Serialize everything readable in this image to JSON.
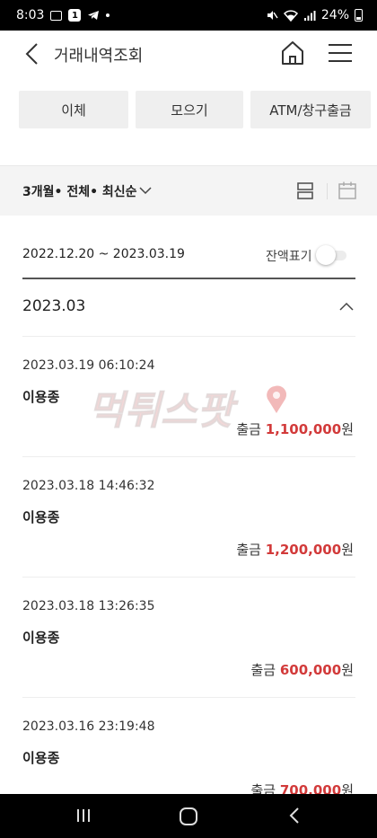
{
  "status_bar": {
    "time": "8:03",
    "battery": "24%"
  },
  "header": {
    "title": "거래내역조회",
    "icons": [
      "back-arrow-icon",
      "home-icon",
      "hamburger-menu-icon"
    ]
  },
  "categories": [
    "이체",
    "모으기",
    "ATM/창구출금"
  ],
  "filter": {
    "summary": "3개월• 전체• 최신순"
  },
  "date_range": "2022.12.20 ~ 2023.03.19",
  "balance_toggle": {
    "label": "잔액표기",
    "on": false
  },
  "month_section": "2023.03",
  "transactions": [
    {
      "datetime": "2023.03.19 06:10:24",
      "name": "이용종",
      "type": "출금",
      "amount": "1,100,000",
      "unit": "원"
    },
    {
      "datetime": "2023.03.18 14:46:32",
      "name": "이용종",
      "type": "출금",
      "amount": "1,200,000",
      "unit": "원"
    },
    {
      "datetime": "2023.03.18 13:26:35",
      "name": "이용종",
      "type": "출금",
      "amount": "600,000",
      "unit": "원"
    },
    {
      "datetime": "2023.03.16 23:19:48",
      "name": "이용종",
      "type": "출금",
      "amount": "700,000",
      "unit": "원"
    }
  ],
  "watermark": "먹튀스팟",
  "colors": {
    "amount": "#d23a3a",
    "button_bg": "#efefef",
    "filter_band": "#f4f4f4"
  }
}
